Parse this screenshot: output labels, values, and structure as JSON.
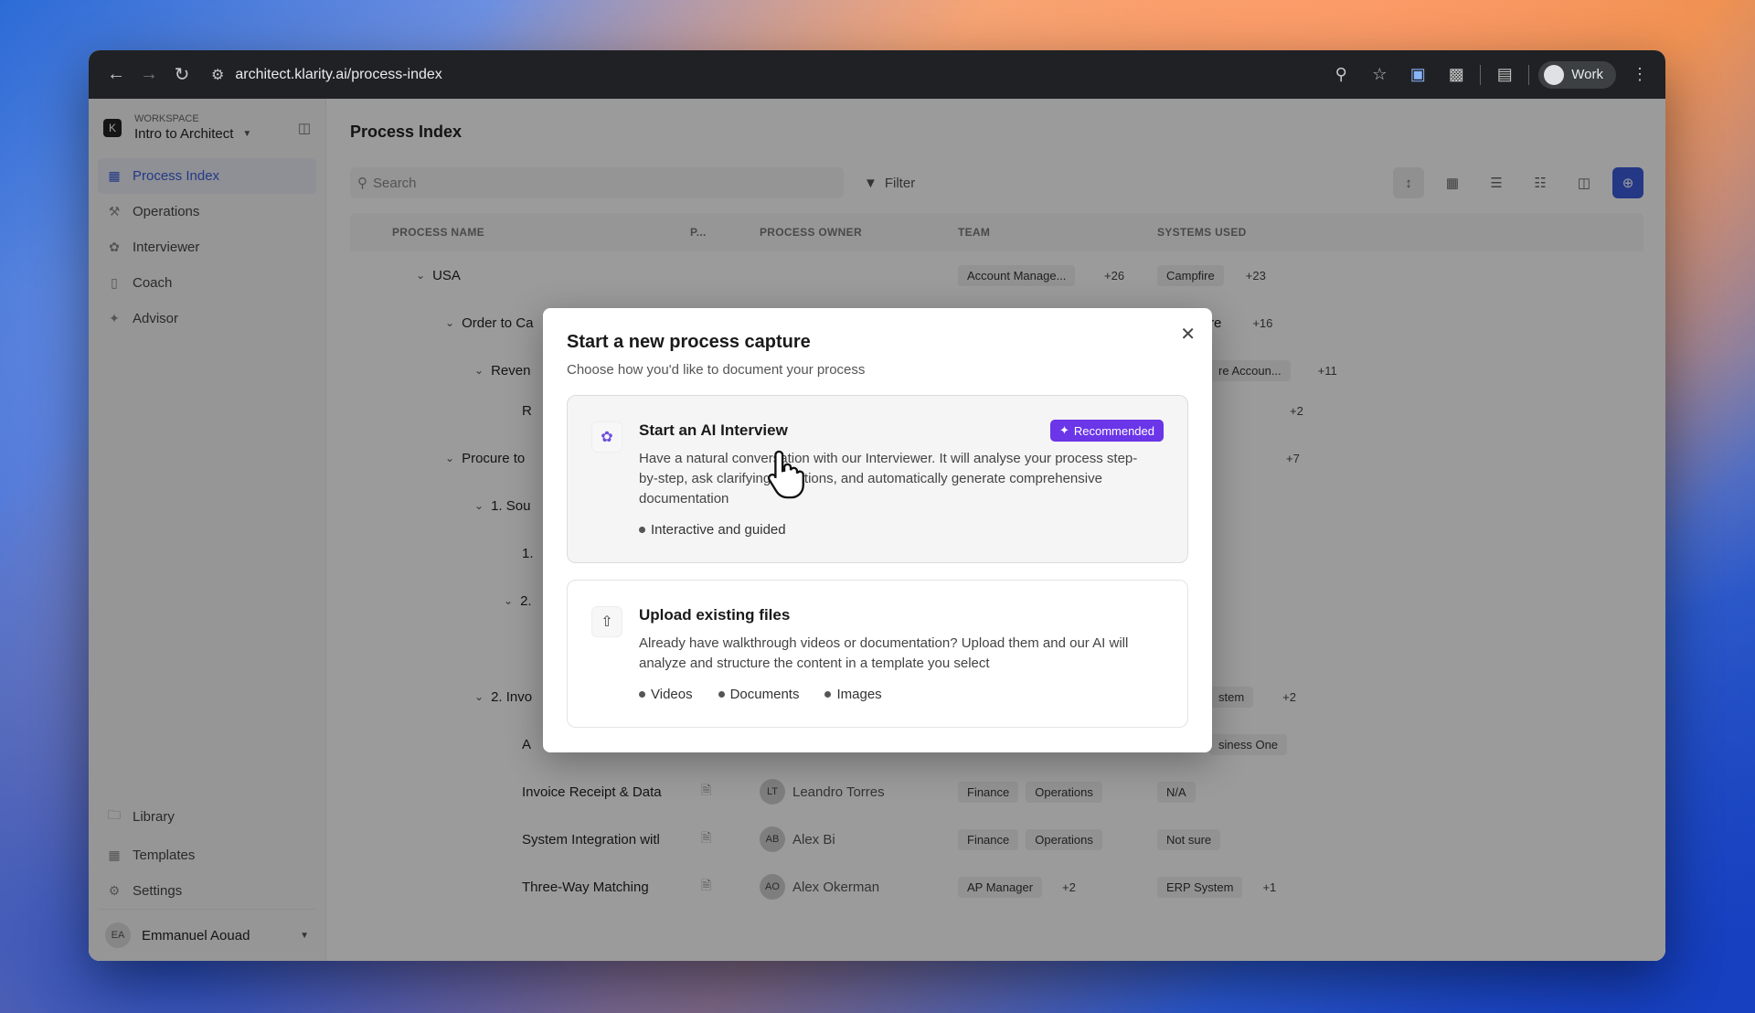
{
  "browser": {
    "url": "architect.klarity.ai/process-index",
    "profile_label": "Work"
  },
  "workspace": {
    "logo_letter": "K",
    "label": "WORKSPACE",
    "name": "Intro to Architect"
  },
  "sidebar": {
    "items": [
      {
        "label": "Process Index",
        "icon": "process-index-icon",
        "active": true
      },
      {
        "label": "Operations",
        "icon": "operations-icon"
      },
      {
        "label": "Interviewer",
        "icon": "interviewer-icon"
      },
      {
        "label": "Coach",
        "icon": "coach-icon"
      },
      {
        "label": "Advisor",
        "icon": "advisor-icon"
      }
    ],
    "bottom_items": [
      {
        "label": "Library",
        "icon": "folder-icon"
      },
      {
        "label": "Templates",
        "icon": "templates-icon"
      },
      {
        "label": "Settings",
        "icon": "gear-icon"
      }
    ],
    "user": {
      "initials": "EA",
      "name": "Emmanuel Aouad"
    }
  },
  "main": {
    "title": "Process Index",
    "search_placeholder": "Search",
    "filter_label": "Filter"
  },
  "table": {
    "columns": [
      "PROCESS NAME",
      "P...",
      "PROCESS OWNER",
      "TEAM",
      "SYSTEMS USED"
    ],
    "rows": [
      {
        "name": "USA",
        "team": "Account Manage...",
        "team_more": "+26",
        "system": "Campfire",
        "system_more": "+23"
      },
      {
        "name": "Order to Ca",
        "system_partial": "re",
        "system_more": "+16"
      },
      {
        "name": "Reven",
        "system": "re Accoun...",
        "system_more": "+11"
      },
      {
        "name": "R",
        "system_more": "+2"
      },
      {
        "name": "Procure to",
        "system_more": "+7"
      },
      {
        "name": "1. Sou"
      },
      {
        "name": "1."
      },
      {
        "name": "2."
      },
      {
        "name": "2. Invo",
        "system": "stem",
        "system_more": "+2"
      },
      {
        "name": "A",
        "system": "siness One"
      },
      {
        "name": "Invoice Receipt & Data",
        "owner_initials": "LT",
        "owner": "Leandro Torres",
        "teams": [
          "Finance",
          "Operations"
        ],
        "system": "N/A"
      },
      {
        "name": "System Integration witl",
        "owner_initials": "AB",
        "owner": "Alex Bi",
        "teams": [
          "Finance",
          "Operations"
        ],
        "system": "Not sure"
      },
      {
        "name": "Three-Way Matching",
        "owner_initials": "AO",
        "owner": "Alex Okerman",
        "teams": [
          "AP Manager"
        ],
        "team_more": "+2",
        "system": "ERP System",
        "system_more": "+1"
      }
    ]
  },
  "modal": {
    "title": "Start a new process capture",
    "subtitle": "Choose how you'd like to document your process",
    "ai_option": {
      "title": "Start an AI Interview",
      "badge": "Recommended",
      "description": "Have a natural conversation with our Interviewer. It will analyse your process step-by-step, ask clarifying questions, and automatically generate comprehensive documentation",
      "bullets": [
        "Interactive and guided"
      ]
    },
    "upload_option": {
      "title": "Upload existing files",
      "description": "Already have walkthrough videos or documentation? Upload them and our AI will analyze and structure the content in a template you select",
      "bullets": [
        "Videos",
        "Documents",
        "Images"
      ]
    }
  },
  "colors": {
    "accent": "#3a5bd9",
    "badge": "#6b35e8"
  }
}
